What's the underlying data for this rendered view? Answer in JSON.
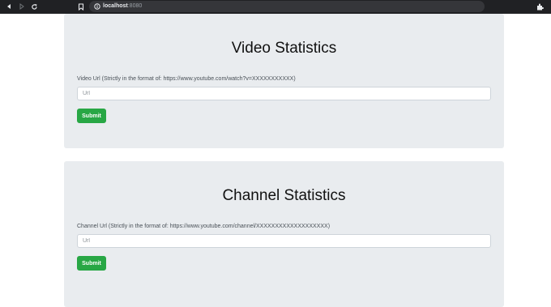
{
  "browser": {
    "url_host": "localhost",
    "url_port": ":8080",
    "icons": [
      "back-arrow-icon",
      "forward-arrow-icon",
      "reload-icon",
      "bookmark-icon",
      "site-info-icon",
      "extensions-icon"
    ]
  },
  "video_section": {
    "title": "Video Statistics",
    "label": "Video Url (Strictly in the format of: https://www.youtube.com/watch?v=XXXXXXXXXXX)",
    "placeholder": "Url",
    "value": "",
    "button_label": "Submit"
  },
  "channel_section": {
    "title": "Channel Statistics",
    "label": "Channel Url (Strictly in the format of: https://www.youtube.com/channel/XXXXXXXXXXXXXXXXXXX)",
    "placeholder": "Url",
    "value": "",
    "button_label": "Submit"
  },
  "colors": {
    "card_background": "#e9ecef",
    "submit_button": "#28a745",
    "browser_chrome": "#202124"
  }
}
